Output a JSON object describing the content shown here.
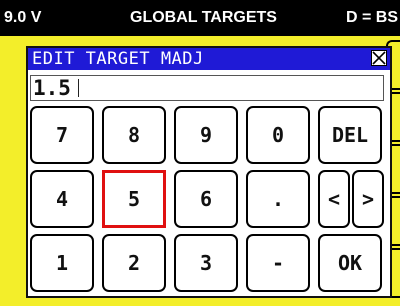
{
  "status": {
    "voltage": "9.0 V",
    "title": "GLOBAL TARGETS",
    "right": "D = BS"
  },
  "dialog": {
    "title": "EDIT TARGET MADJ",
    "value": "1.5"
  },
  "keypad": {
    "row1": [
      "7",
      "8",
      "9",
      "0",
      "DEL"
    ],
    "row2": [
      "4",
      "5",
      "6",
      ".",
      "<",
      ">"
    ],
    "row3": [
      "1",
      "2",
      "3",
      "-",
      "OK"
    ],
    "selected_key": "5"
  },
  "colors": {
    "title_bar": "#1f1ad6",
    "background": "#f3ee2a",
    "selection": "#e01010"
  }
}
